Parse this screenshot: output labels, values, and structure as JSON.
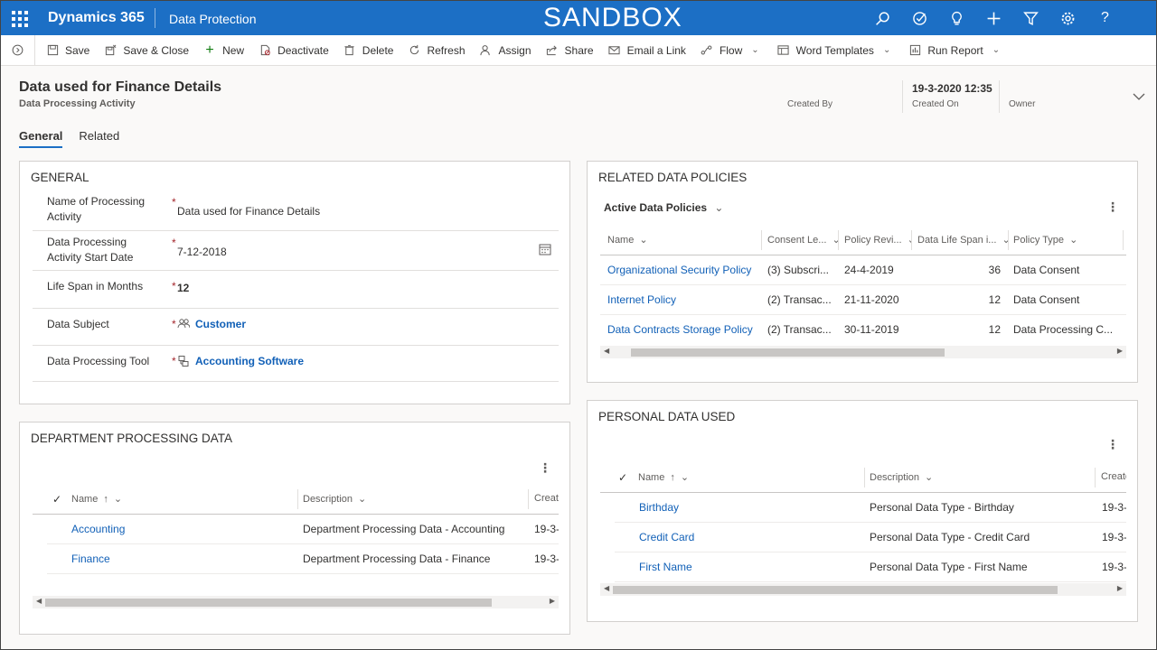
{
  "topnav": {
    "brand": "Dynamics 365",
    "app_name": "Data Protection",
    "environment": "SANDBOX",
    "icons": [
      "search-icon",
      "task-icon",
      "lightbulb-icon",
      "plus-icon",
      "filter-icon",
      "gear-icon",
      "help-icon"
    ]
  },
  "commands": {
    "save": "Save",
    "save_close": "Save & Close",
    "new": "New",
    "deactivate": "Deactivate",
    "delete": "Delete",
    "refresh": "Refresh",
    "assign": "Assign",
    "share": "Share",
    "email_link": "Email a Link",
    "flow": "Flow",
    "word_templates": "Word Templates",
    "run_report": "Run Report"
  },
  "header": {
    "title": "Data used for Finance Details",
    "entity": "Data Processing Activity",
    "created_by_label": "Created By",
    "created_by_value": "",
    "created_on_value": "19-3-2020 12:35",
    "created_on_label": "Created On",
    "owner_label": "Owner",
    "owner_value": ""
  },
  "tabs": [
    {
      "label": "General",
      "active": true
    },
    {
      "label": "Related",
      "active": false
    }
  ],
  "general": {
    "title": "GENERAL",
    "fields": {
      "name_label": "Name of Processing Activity",
      "name_value": "Data used for Finance Details",
      "start_label": "Data Processing Activity Start Date",
      "start_value": "7-12-2018",
      "lifespan_label": "Life Span in Months",
      "lifespan_value": "12",
      "subject_label": "Data Subject",
      "subject_value": "Customer",
      "tool_label": "Data Processing Tool",
      "tool_value": "Accounting Software"
    }
  },
  "policies": {
    "title": "RELATED DATA POLICIES",
    "view": "Active Data Policies",
    "columns": {
      "name": "Name",
      "consent": "Consent Le...",
      "review": "Policy Revi...",
      "lifespan": "Data Life Span i...",
      "type": "Policy Type"
    },
    "rows": [
      {
        "name": "Organizational Security Policy",
        "consent": "(3) Subscri...",
        "review": "24-4-2019",
        "lifespan": "36",
        "type": "Data Consent"
      },
      {
        "name": "Internet Policy",
        "consent": "(2) Transac...",
        "review": "21-11-2020",
        "lifespan": "12",
        "type": "Data Consent"
      },
      {
        "name": "Data Contracts Storage Policy",
        "consent": "(2) Transac...",
        "review": "30-11-2019",
        "lifespan": "12",
        "type": "Data Processing C..."
      }
    ]
  },
  "department": {
    "title": "DEPARTMENT PROCESSING DATA",
    "columns": {
      "name": "Name",
      "description": "Description",
      "created": "Create"
    },
    "rows": [
      {
        "name": "Accounting",
        "description": "Department Processing Data - Accounting",
        "created": "19-3-"
      },
      {
        "name": "Finance",
        "description": "Department Processing Data - Finance",
        "created": "19-3-"
      }
    ]
  },
  "personal": {
    "title": "PERSONAL DATA USED",
    "columns": {
      "name": "Name",
      "description": "Description",
      "created": "Create"
    },
    "rows": [
      {
        "name": "Birthday",
        "description": "Personal Data Type - Birthday",
        "created": "19-3-"
      },
      {
        "name": "Credit Card",
        "description": "Personal Data Type - Credit Card",
        "created": "19-3-"
      },
      {
        "name": "First Name",
        "description": "Personal Data Type - First Name",
        "created": "19-3-"
      }
    ]
  },
  "colors": {
    "nav": "#1c6fc5",
    "link": "#1160b7",
    "required": "#a4262c"
  }
}
